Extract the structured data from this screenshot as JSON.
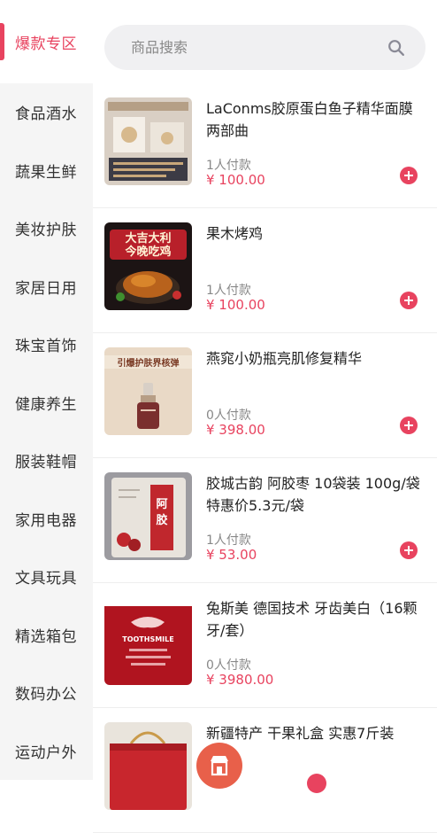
{
  "search": {
    "placeholder": "商品搜索"
  },
  "categories": [
    {
      "label": "爆款专区",
      "active": true
    },
    {
      "label": "食品酒水"
    },
    {
      "label": "蔬果生鲜"
    },
    {
      "label": "美妆护肤"
    },
    {
      "label": "家居日用"
    },
    {
      "label": "珠宝首饰"
    },
    {
      "label": "健康养生"
    },
    {
      "label": "服装鞋帽"
    },
    {
      "label": "家用电器"
    },
    {
      "label": "文具玩具"
    },
    {
      "label": "精选箱包"
    },
    {
      "label": "数码办公"
    },
    {
      "label": "运动户外"
    }
  ],
  "products": [
    {
      "title": "LaConms胶原蛋白鱼子精华面膜两部曲",
      "sold": "1人付款",
      "price": "¥ 100.00",
      "thumb_text": ""
    },
    {
      "title": "果木烤鸡",
      "sold": "1人付款",
      "price": "¥ 100.00",
      "thumb_text": "大吉大利\n今晚吃鸡"
    },
    {
      "title": "燕窕小奶瓶亮肌修复精华",
      "sold": "0人付款",
      "price": "¥ 398.00",
      "thumb_text": "引爆护肤界核弹"
    },
    {
      "title": "胶城古韵 阿胶枣 10袋装 100g/袋 特惠价5.3元/袋",
      "sold": "1人付款",
      "price": "¥ 53.00",
      "thumb_text": "阿胶"
    },
    {
      "title": "兔斯美 德国技术 牙齿美白（16颗牙/套）",
      "sold": "0人付款",
      "price": "¥ 3980.00",
      "thumb_text": "TOOTHSMILE"
    },
    {
      "title": "新疆特产 干果礼盒 实惠7斤装",
      "sold": "",
      "price": "",
      "thumb_text": ""
    }
  ],
  "colors": {
    "accent": "#e8435f",
    "fab": "#e8604a"
  },
  "icons": {
    "search": "search-icon",
    "add": "plus-circle-icon",
    "store": "store-icon"
  }
}
